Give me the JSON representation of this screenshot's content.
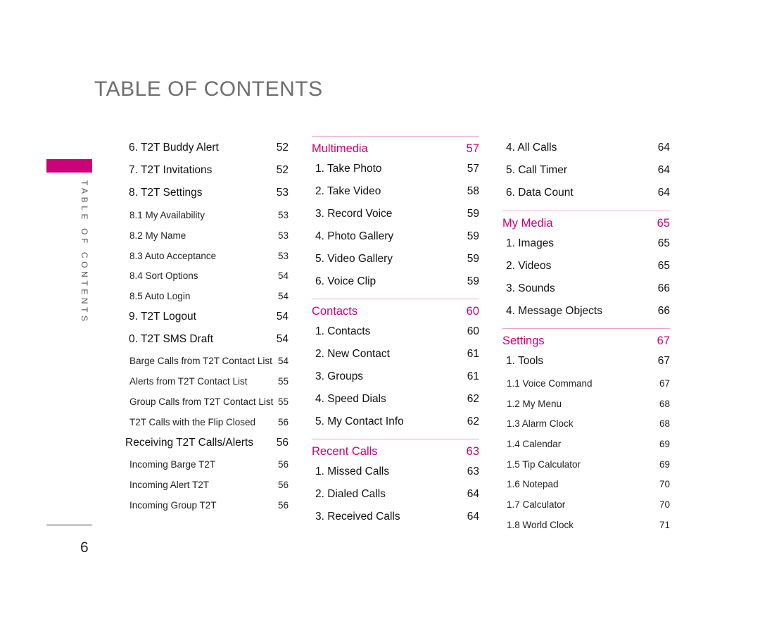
{
  "page": {
    "title": "TABLE OF CONTENTS",
    "side_label": "TABLE OF CONTENTS",
    "page_number": "6",
    "accent_color": "#cc0077"
  },
  "columns": [
    {
      "entries": [
        {
          "type": "item",
          "label": "6. T2T Buddy Alert",
          "page": "52"
        },
        {
          "type": "item",
          "label": "7. T2T Invitations",
          "page": "52"
        },
        {
          "type": "item",
          "label": "8. T2T Settings",
          "page": "53"
        },
        {
          "type": "sub",
          "label": "8.1 My Availability",
          "page": "53"
        },
        {
          "type": "sub",
          "label": "8.2 My Name",
          "page": "53"
        },
        {
          "type": "sub",
          "label": "8.3 Auto Acceptance",
          "page": "53"
        },
        {
          "type": "sub",
          "label": "8.4 Sort Options",
          "page": "54"
        },
        {
          "type": "sub",
          "label": "8.5 Auto Login",
          "page": "54"
        },
        {
          "type": "item",
          "label": "9. T2T Logout",
          "page": "54"
        },
        {
          "type": "item",
          "label": "0. T2T SMS Draft",
          "page": "54"
        },
        {
          "type": "sub",
          "label": "Barge Calls from T2T Contact List",
          "page": "54"
        },
        {
          "type": "sub",
          "label": "Alerts from T2T Contact List",
          "page": "55"
        },
        {
          "type": "sub",
          "label": "Group Calls from T2T Contact List",
          "page": "55"
        },
        {
          "type": "sub",
          "label": "T2T Calls with the Flip Closed",
          "page": "56"
        },
        {
          "type": "bold",
          "label": "Receiving T2T Calls/Alerts",
          "page": "56"
        },
        {
          "type": "sub",
          "label": "Incoming Barge T2T",
          "page": "56"
        },
        {
          "type": "sub",
          "label": "Incoming Alert T2T",
          "page": "56"
        },
        {
          "type": "sub",
          "label": "Incoming Group T2T",
          "page": "56"
        }
      ]
    },
    {
      "entries": [
        {
          "type": "section",
          "label": "Multimedia",
          "page": "57"
        },
        {
          "type": "item",
          "label": "1. Take Photo",
          "page": "57"
        },
        {
          "type": "item",
          "label": "2. Take Video",
          "page": "58"
        },
        {
          "type": "item",
          "label": "3. Record Voice",
          "page": "59"
        },
        {
          "type": "item",
          "label": "4. Photo Gallery",
          "page": "59"
        },
        {
          "type": "item",
          "label": "5. Video Gallery",
          "page": "59"
        },
        {
          "type": "item",
          "label": "6. Voice Clip",
          "page": "59"
        },
        {
          "type": "section",
          "label": "Contacts",
          "page": "60"
        },
        {
          "type": "item",
          "label": "1. Contacts",
          "page": "60"
        },
        {
          "type": "item",
          "label": "2. New Contact",
          "page": "61"
        },
        {
          "type": "item",
          "label": "3. Groups",
          "page": "61"
        },
        {
          "type": "item",
          "label": "4. Speed Dials",
          "page": "62"
        },
        {
          "type": "item",
          "label": "5. My Contact Info",
          "page": "62"
        },
        {
          "type": "section",
          "label": "Recent Calls",
          "page": "63"
        },
        {
          "type": "item",
          "label": "1. Missed Calls",
          "page": "63"
        },
        {
          "type": "item",
          "label": "2. Dialed Calls",
          "page": "64"
        },
        {
          "type": "item",
          "label": "3. Received Calls",
          "page": "64"
        }
      ]
    },
    {
      "entries": [
        {
          "type": "item",
          "label": "4. All Calls",
          "page": "64"
        },
        {
          "type": "item",
          "label": "5. Call Timer",
          "page": "64"
        },
        {
          "type": "item",
          "label": "6. Data Count",
          "page": "64"
        },
        {
          "type": "section",
          "label": "My Media",
          "page": "65"
        },
        {
          "type": "item",
          "label": "1. Images",
          "page": "65"
        },
        {
          "type": "item",
          "label": "2. Videos",
          "page": "65"
        },
        {
          "type": "item",
          "label": "3. Sounds",
          "page": "66"
        },
        {
          "type": "item",
          "label": "4. Message Objects",
          "page": "66"
        },
        {
          "type": "section",
          "label": "Settings",
          "page": "67"
        },
        {
          "type": "item",
          "label": "1. Tools",
          "page": "67"
        },
        {
          "type": "sub",
          "label": "1.1 Voice Command",
          "page": "67"
        },
        {
          "type": "sub",
          "label": "1.2 My Menu",
          "page": "68"
        },
        {
          "type": "sub",
          "label": "1.3 Alarm Clock",
          "page": "68"
        },
        {
          "type": "sub",
          "label": "1.4 Calendar",
          "page": "69"
        },
        {
          "type": "sub",
          "label": "1.5 Tip Calculator",
          "page": "69"
        },
        {
          "type": "sub",
          "label": "1.6 Notepad",
          "page": "70"
        },
        {
          "type": "sub",
          "label": "1.7 Calculator",
          "page": "70"
        },
        {
          "type": "sub",
          "label": "1.8 World Clock",
          "page": "71"
        }
      ]
    }
  ]
}
